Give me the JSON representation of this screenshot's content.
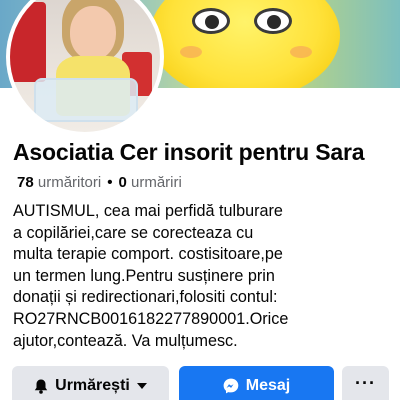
{
  "profile": {
    "name": "Asociatia Cer insorit pentru Sara",
    "followers_count": "78",
    "followers_label": "urmăritori",
    "following_count": "0",
    "following_label": "urmăriri",
    "bio": "AUTISMUL, cea mai perfidă tulburare\na copilăriei,care se corecteaza cu\nmulta terapie comport. costisitoare,pe\nun termen lung.Pentru susținere prin\ndonații și redirectionari,folositi contul:\nRO27RNCB0016182277890001.Orice\najutor,contează. Va mulțumesc."
  },
  "actions": {
    "follow_label": "Urmărești",
    "message_label": "Mesaj",
    "more_label": "···"
  },
  "icons": {
    "follow": "bell-icon",
    "follow_menu": "chevron-down-icon",
    "message": "messenger-icon"
  },
  "colors": {
    "primary": "#1877f2",
    "secondary_button": "#e4e6eb",
    "muted_text": "#65676b"
  }
}
